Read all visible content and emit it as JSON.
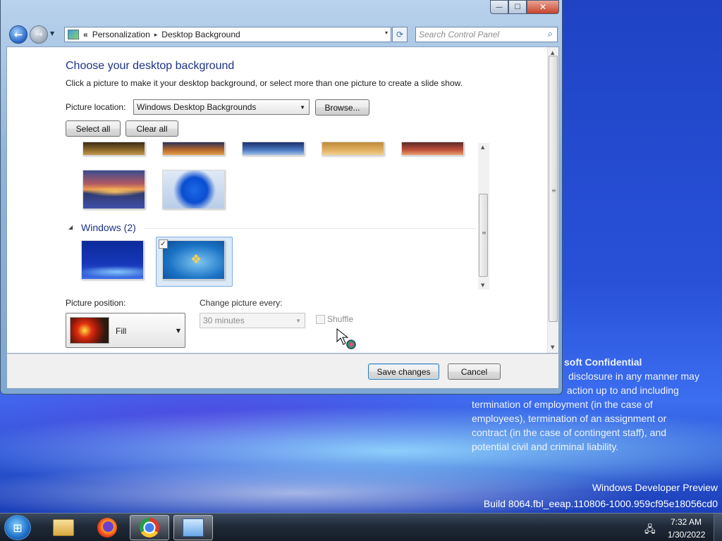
{
  "desktop": {
    "confidential": {
      "title": "soft Confidential",
      "lines": [
        "disclosure in any manner may",
        "action up to and including",
        "termination of employment (in the case of",
        "employees), termination of an assignment or",
        "contract (in the case of contingent staff), and",
        "potential civil and criminal liability."
      ]
    },
    "watermark": {
      "preview": "Windows Developer Preview",
      "build": "Build 8064.fbl_eeap.110806-1000.959cf95e18056cd0"
    }
  },
  "window": {
    "caption_buttons": {
      "minimize": "—",
      "maximize": "☐",
      "close": "✕"
    },
    "nav": {
      "back_glyph": "←",
      "forward_glyph": "→",
      "dropdown_glyph": "▼"
    },
    "address": {
      "chevron": "«",
      "crumbs": [
        "Personalization",
        "Desktop Background"
      ],
      "separator": "▸",
      "dropdown_glyph": "▾"
    },
    "refresh_glyph": "⟳",
    "search": {
      "placeholder": "Search Control Panel",
      "icon": "search-icon"
    },
    "content": {
      "title": "Choose your desktop background",
      "subtitle": "Click a picture to make it your desktop background, or select more than one picture to create a slide show.",
      "picture_location_label": "Picture location:",
      "picture_location_value": "Windows Desktop Backgrounds",
      "browse_label": "Browse...",
      "select_all_label": "Select all",
      "clear_all_label": "Clear all",
      "group": {
        "label": "Windows (2)",
        "collapse_glyph": "◢"
      },
      "selected_check": "✓",
      "picture_position_label": "Picture position:",
      "picture_position_value": "Fill",
      "change_every_label": "Change picture every:",
      "change_every_value": "30 minutes",
      "shuffle_label": "Shuffle",
      "shuffle_checked": false,
      "dropdown_glyph": "▼"
    },
    "footer": {
      "save_label": "Save changes",
      "cancel_label": "Cancel"
    }
  },
  "scrollbar": {
    "up": "▲",
    "down": "▼",
    "grip": "≡"
  },
  "taskbar": {
    "start_glyph": "⊞",
    "apps": [
      "windows-explorer",
      "firefox",
      "chrome",
      "control-panel"
    ],
    "active_app": "control-panel",
    "tray_network_glyph": "🖧",
    "clock_time": "7:32 AM",
    "clock_date": "1/30/2022"
  }
}
